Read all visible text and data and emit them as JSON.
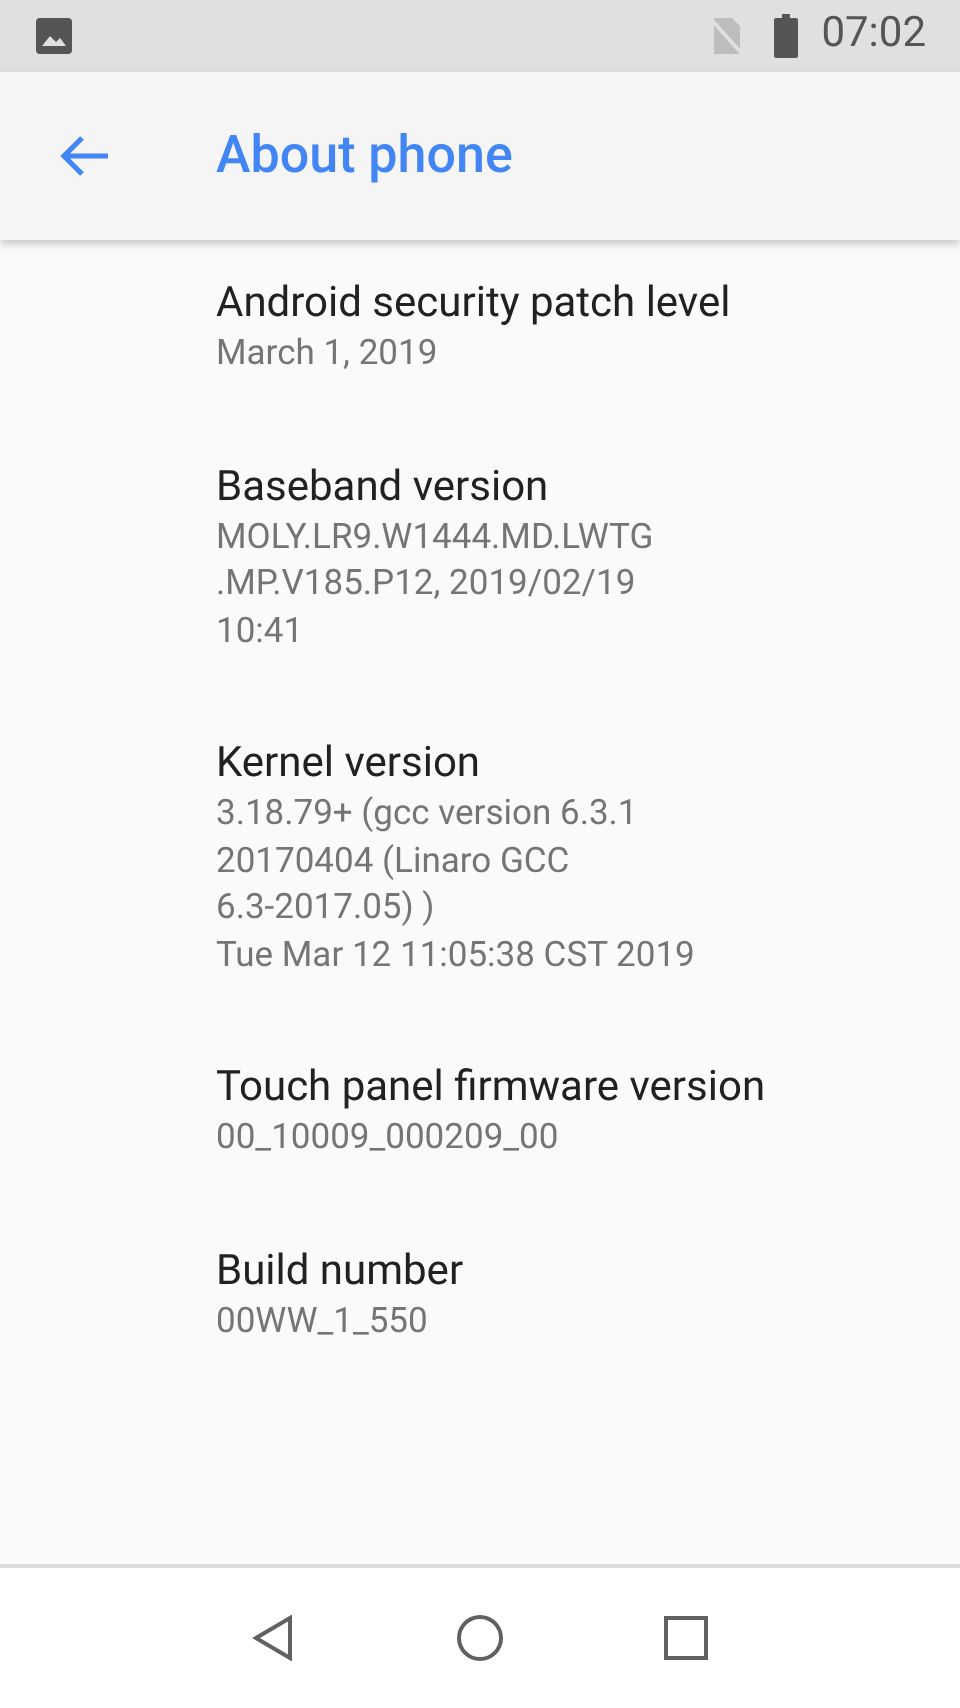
{
  "status_bar": {
    "time": "07:02"
  },
  "app_bar": {
    "title": "About phone"
  },
  "items": [
    {
      "title": "Android security patch level",
      "summary": [
        "March 1, 2019"
      ]
    },
    {
      "title": "Baseband version",
      "summary": [
        "MOLY.LR9.W1444.MD.LWTG",
        ".MP.V185.P12, 2019/02/19",
        "10:41"
      ]
    },
    {
      "title": "Kernel version",
      "summary": [
        "3.18.79+ (gcc version 6.3.1",
        "20170404 (Linaro GCC",
        "6.3-2017.05) )",
        "Tue Mar 12 11:05:38 CST 2019"
      ]
    },
    {
      "title": "Touch panel firmware version",
      "summary": [
        "00_10009_000209_00"
      ]
    },
    {
      "title": "Build number",
      "summary": [
        "00WW_1_550"
      ]
    }
  ]
}
